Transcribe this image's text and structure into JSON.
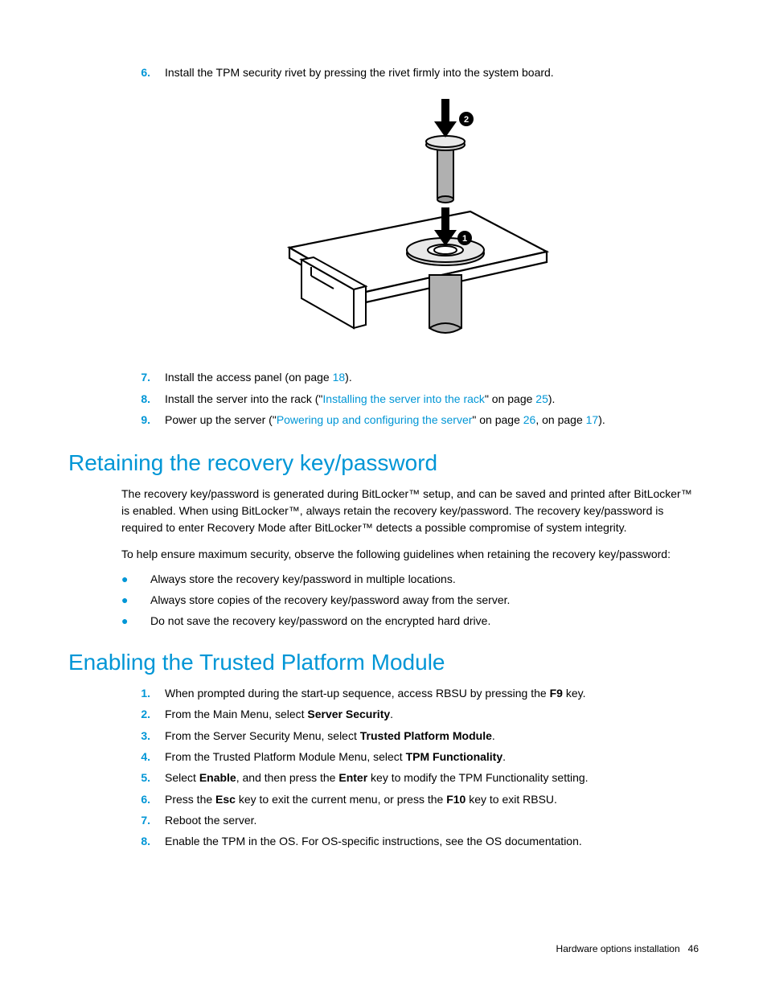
{
  "steps_top": {
    "6": {
      "num": "6.",
      "text": "Install the TPM security rivet by pressing the rivet firmly into the system board."
    },
    "7": {
      "num": "7.",
      "pre": "Install the access panel (on page ",
      "link": "18",
      "post": ")."
    },
    "8": {
      "num": "8.",
      "pre": "Install the server into the rack (\"",
      "link1": "Installing the server into the rack",
      "mid": "\" on page ",
      "link2": "25",
      "post": ")."
    },
    "9": {
      "num": "9.",
      "pre": "Power up the server (\"",
      "link1": "Powering up and configuring the server",
      "mid1": "\" on page ",
      "link2": "26",
      "mid2": ", on page ",
      "link3": "17",
      "post": ")."
    }
  },
  "h_retain": "Retaining the recovery key/password",
  "p_retain1": "The recovery key/password is generated during BitLocker™ setup, and can be saved and printed after BitLocker™ is enabled. When using BitLocker™, always retain the recovery key/password. The recovery key/password is required to enter Recovery Mode after BitLocker™ detects a possible compromise of system integrity.",
  "p_retain2": "To help ensure maximum security, observe the following guidelines when retaining the recovery key/password:",
  "bullets": {
    "b1": "Always store the recovery key/password in multiple locations.",
    "b2": "Always store copies of the recovery key/password away from the server.",
    "b3": "Do not save the recovery key/password on the encrypted hard drive."
  },
  "h_enable": "Enabling the Trusted Platform Module",
  "steps_enable": {
    "1": {
      "num": "1.",
      "pre": "When prompted during the start-up sequence, access RBSU by pressing the ",
      "b1": "F9",
      "post": " key."
    },
    "2": {
      "num": "2.",
      "pre": "From the Main Menu, select ",
      "b1": "Server Security",
      "post": "."
    },
    "3": {
      "num": "3.",
      "pre": "From the Server Security Menu, select ",
      "b1": "Trusted Platform Module",
      "post": "."
    },
    "4": {
      "num": "4.",
      "pre": "From the Trusted Platform Module Menu, select ",
      "b1": "TPM Functionality",
      "post": "."
    },
    "5": {
      "num": "5.",
      "pre": "Select ",
      "b1": "Enable",
      "mid": ", and then press the ",
      "b2": "Enter",
      "post": " key to modify the TPM Functionality setting."
    },
    "6": {
      "num": "6.",
      "pre": "Press the ",
      "b1": "Esc",
      "mid": " key to exit the current menu, or press the ",
      "b2": "F10",
      "post": " key to exit RBSU."
    },
    "7": {
      "num": "7.",
      "text": "Reboot the server."
    },
    "8": {
      "num": "8.",
      "text": "Enable the TPM in the OS. For OS-specific instructions, see the OS documentation."
    }
  },
  "footer": {
    "section": "Hardware options installation",
    "page": "46"
  },
  "callouts": {
    "c1": "1",
    "c2": "2"
  }
}
